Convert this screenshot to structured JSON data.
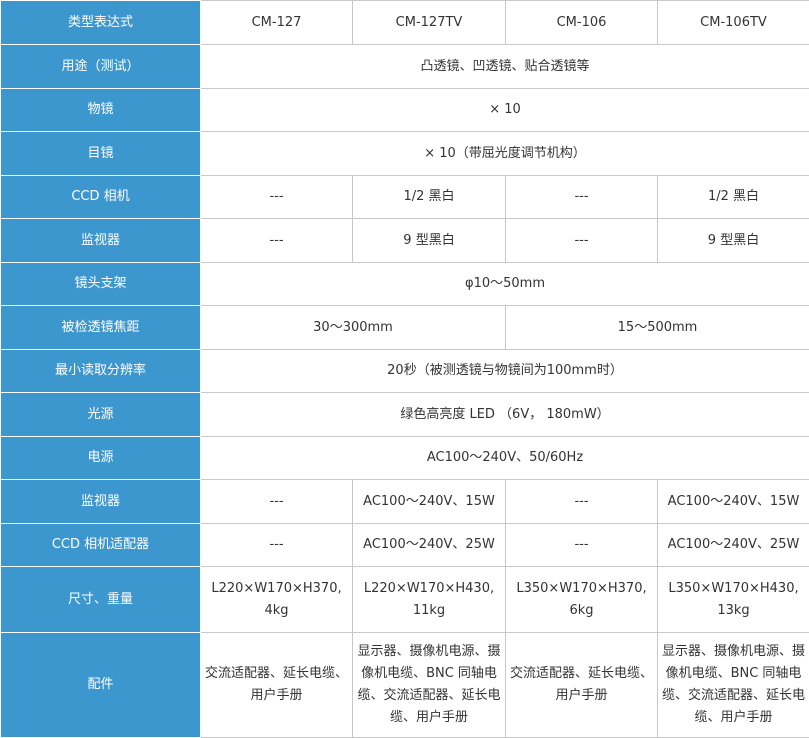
{
  "header": {
    "label": "类型表达式",
    "models": [
      "CM-127",
      "CM-127TV",
      "CM-106",
      "CM-106TV"
    ]
  },
  "rows": {
    "usage": {
      "label": "用途（测试）",
      "value": "凸透镜、凹透镜、贴合透镜等"
    },
    "objective": {
      "label": "物镜",
      "value": "× 10"
    },
    "eyepiece": {
      "label": "目镜",
      "value": "× 10（带屈光度调节机构）"
    },
    "ccd_camera": {
      "label": "CCD 相机",
      "values": [
        "---",
        "1/2 黑白",
        "---",
        "1/2 黑白"
      ]
    },
    "monitor": {
      "label": "监视器",
      "values": [
        "---",
        "9 型黑白",
        "---",
        "9 型黑白"
      ]
    },
    "lens_holder": {
      "label": "镜头支架",
      "value": "φ10～50mm"
    },
    "focal_length": {
      "label": "被检透镜焦距",
      "values": [
        "30～300mm",
        "15～500mm"
      ]
    },
    "resolution": {
      "label": "最小读取分辨率",
      "value": "20秒（被测透镜与物镜间为100mm时）"
    },
    "light_source": {
      "label": "光源",
      "value": "绿色高亮度 LED （6V， 180mW）"
    },
    "power": {
      "label": "电源",
      "value": "AC100～240V、50/60Hz"
    },
    "monitor_power": {
      "label": "监视器",
      "values": [
        "---",
        "AC100～240V、15W",
        "---",
        "AC100～240V、15W"
      ]
    },
    "ccd_adapter": {
      "label": "CCD 相机适配器",
      "values": [
        "---",
        "AC100～240V、25W",
        "---",
        "AC100～240V、25W"
      ]
    },
    "size_weight": {
      "label": "尺寸、重量",
      "values": [
        {
          "dims": "L220×W170×H370,",
          "weight": "4kg"
        },
        {
          "dims": "L220×W170×H430,",
          "weight": "11kg"
        },
        {
          "dims": "L350×W170×H370,",
          "weight": "6kg"
        },
        {
          "dims": "L350×W170×H430,",
          "weight": "13kg"
        }
      ]
    },
    "accessories": {
      "label": "配件",
      "values": [
        "交流适配器、延长电缆、用户手册",
        "显示器、摄像机电源、摄像机电缆、BNC 同轴电缆、交流适配器、延长电缆、用户手册",
        "交流适配器、延长电缆、用户手册",
        "显示器、摄像机电源、摄像机电缆、BNC 同轴电缆、交流适配器、延长电缆、用户手册"
      ]
    }
  }
}
